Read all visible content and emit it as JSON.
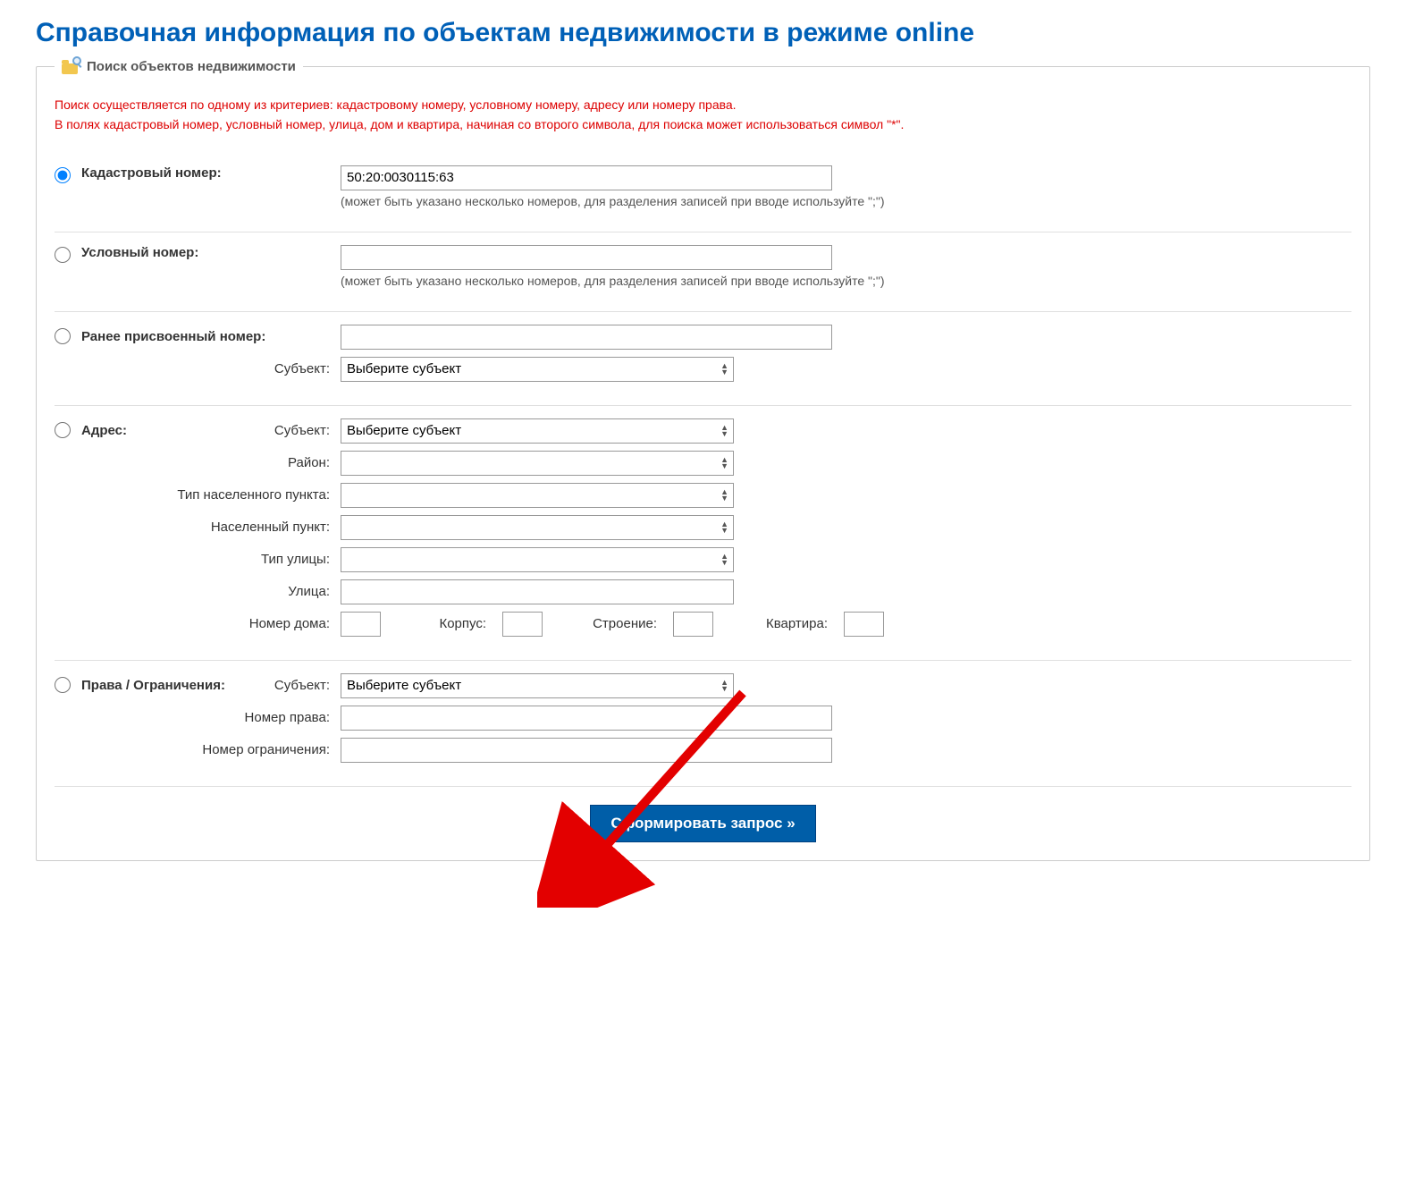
{
  "page": {
    "title": "Справочная информация по объектам недвижимости в режиме online"
  },
  "fieldset": {
    "legend": "Поиск объектов недвижимости"
  },
  "info": {
    "line1": "Поиск осуществляется по одному из критериев: кадастровому номеру, условному номеру, адресу или номеру права.",
    "line2": "В полях кадастровый номер, условный номер, улица, дом и квартира, начиная со второго символа, для поиска может использоваться символ \"*\"."
  },
  "cadastral": {
    "label": "Кадастровый номер:",
    "value": "50:20:0030115:63",
    "hint": "(может быть указано несколько номеров, для разделения записей при вводе используйте \";\")"
  },
  "conditional": {
    "label": "Условный номер:",
    "value": "",
    "hint": "(может быть указано несколько номеров, для разделения записей при вводе используйте \";\")"
  },
  "previous": {
    "label": "Ранее присвоенный номер:",
    "value": "",
    "subject_label": "Субъект:",
    "subject_option": "Выберите субъект"
  },
  "address": {
    "label": "Адрес:",
    "subject_label": "Субъект:",
    "subject_option": "Выберите субъект",
    "district_label": "Район:",
    "settlement_type_label": "Тип населенного пункта:",
    "settlement_label": "Населенный пункт:",
    "street_type_label": "Тип улицы:",
    "street_label": "Улица:",
    "house_label": "Номер дома:",
    "corpus_label": "Корпус:",
    "building_label": "Строение:",
    "flat_label": "Квартира:"
  },
  "rights": {
    "label": "Права / Ограничения:",
    "subject_label": "Субъект:",
    "subject_option": "Выберите субъект",
    "right_number_label": "Номер права:",
    "restriction_number_label": "Номер ограничения:"
  },
  "submit": {
    "label": "Сформировать запрос »"
  }
}
